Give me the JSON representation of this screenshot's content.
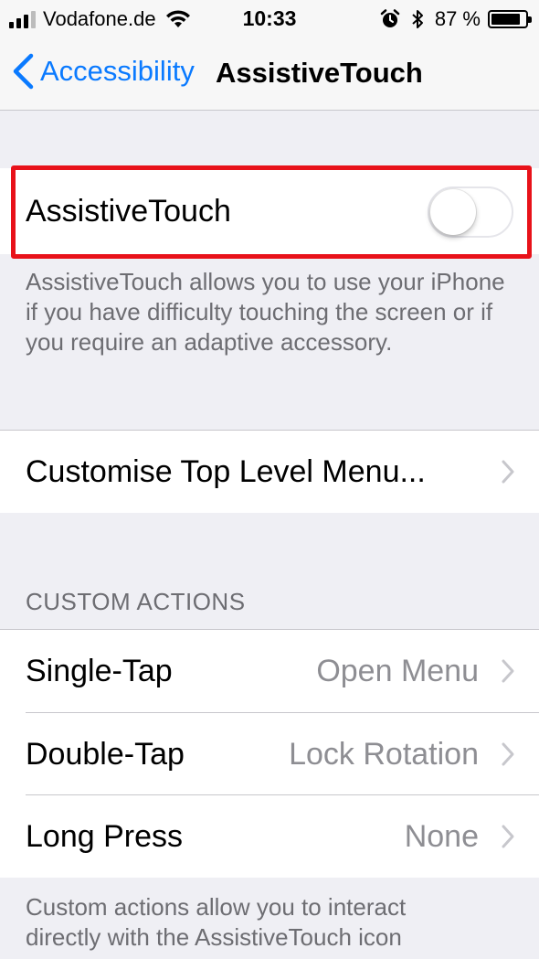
{
  "status_bar": {
    "carrier": "Vodafone.de",
    "time": "10:33",
    "battery_percent": "87 %",
    "battery_level": 0.87
  },
  "nav": {
    "back_label": "Accessibility",
    "title": "AssistiveTouch"
  },
  "assistive_touch": {
    "label": "AssistiveTouch",
    "enabled": false,
    "description": "AssistiveTouch allows you to use your iPhone if you have difficulty touching the screen or if you require an adaptive accessory."
  },
  "customise_menu": {
    "label": "Customise Top Level Menu..."
  },
  "custom_actions": {
    "header": "CUSTOM ACTIONS",
    "rows": [
      {
        "label": "Single-Tap",
        "value": "Open Menu"
      },
      {
        "label": "Double-Tap",
        "value": "Lock Rotation"
      },
      {
        "label": "Long Press",
        "value": "None"
      }
    ],
    "footer": "Custom actions allow you to interact directly with the AssistiveTouch icon"
  },
  "colors": {
    "accent": "#0a7aff",
    "highlight_box": "#e8121a",
    "background": "#efeff4",
    "secondary_text": "#8e8e93"
  }
}
